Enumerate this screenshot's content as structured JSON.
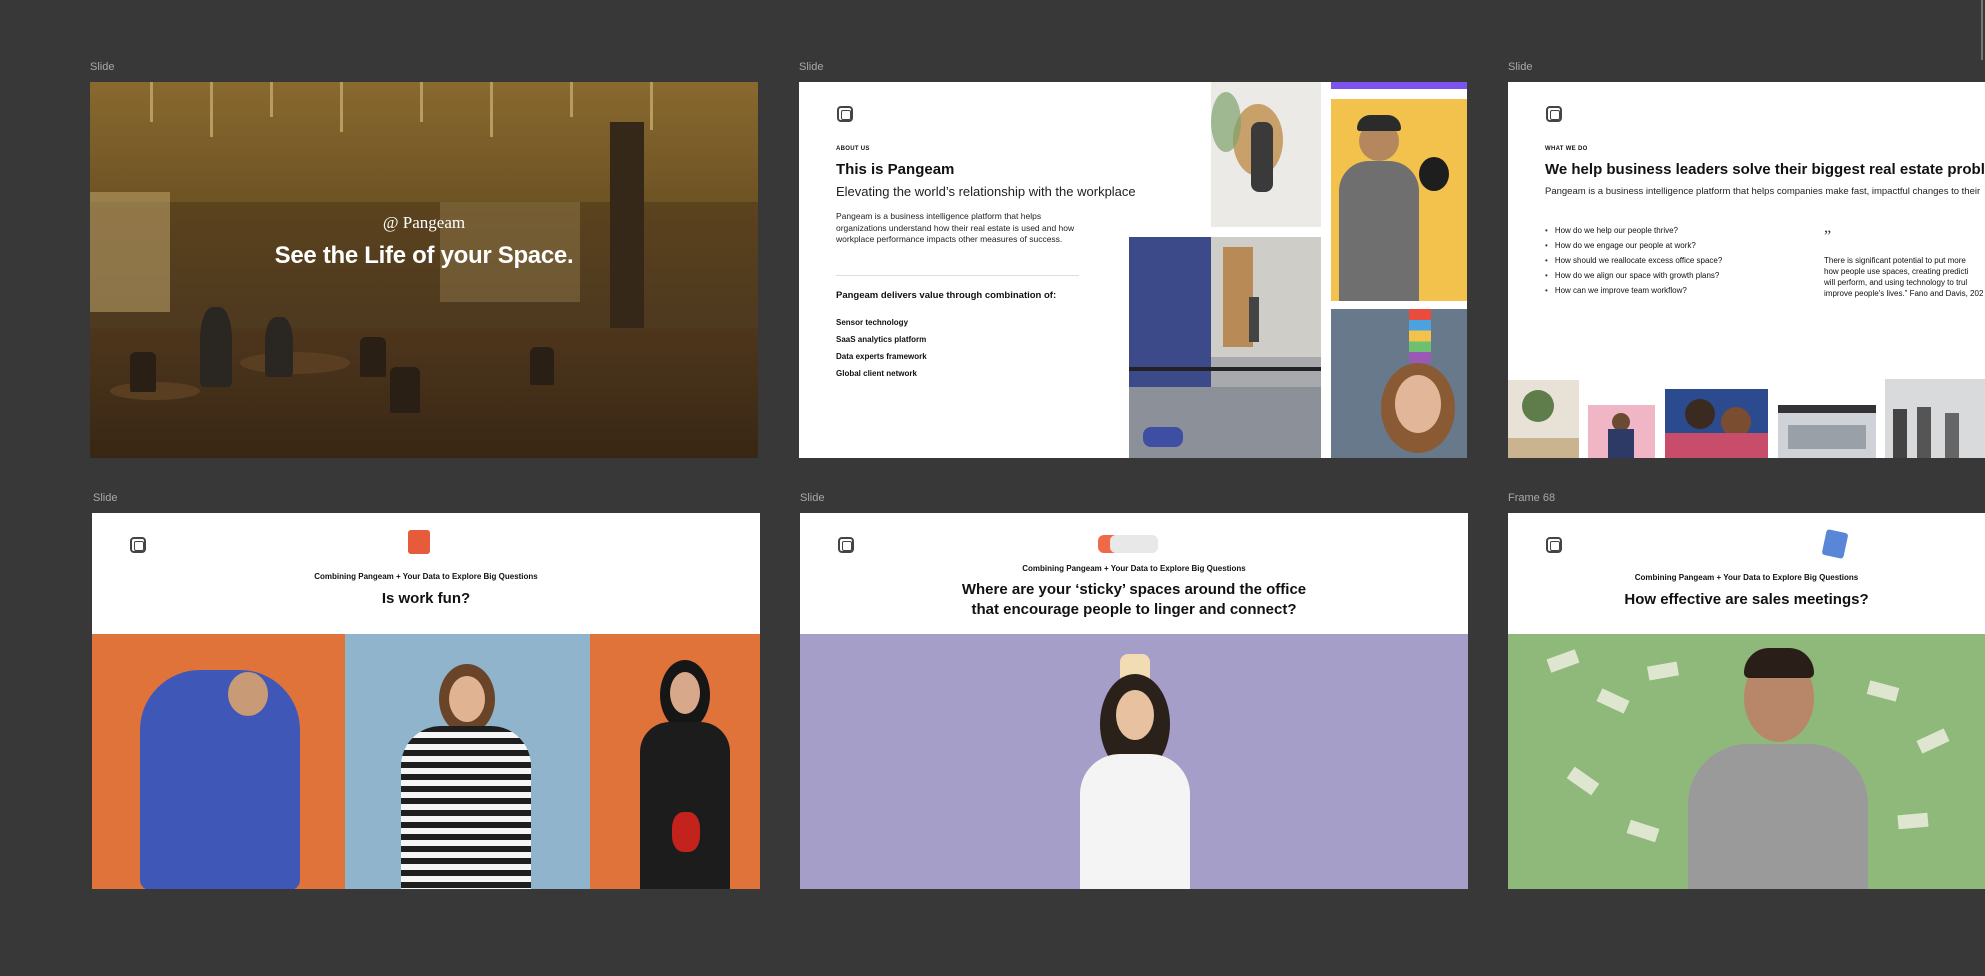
{
  "canvas": {
    "frames": [
      {
        "label": "Slide"
      },
      {
        "label": "Slide"
      },
      {
        "label": "Slide"
      },
      {
        "label": "Slide"
      },
      {
        "label": "Slide"
      },
      {
        "label": "Frame 68"
      }
    ]
  },
  "slide1": {
    "logo": "@ Pangeam",
    "title": "See the Life of your Space."
  },
  "slide2": {
    "eyebrow": "ABOUT US",
    "title": "This is Pangeam",
    "subtitle": "Elevating the world’s relationship with the workplace",
    "body": "Pangeam is a business intelligence platform that helps organizations understand how their real estate is used and how workplace performance impacts other measures of success.",
    "lead": "Pangeam delivers value through combination of:",
    "items": [
      "Sensor technology",
      "SaaS analytics platform",
      "Data experts framework",
      "Global client network"
    ]
  },
  "slide3": {
    "eyebrow": "WHAT WE DO",
    "title": "We help business leaders solve their biggest real estate proble",
    "subtitle": "Pangeam is a business intelligence platform that helps companies make fast, impactful changes to their",
    "questions": [
      "How do we help our people thrive?",
      "How do we engage our people at work?",
      "How should we reallocate excess office space?",
      "How do we align our space with growth plans?",
      "How can we improve team workflow?"
    ],
    "quote_mark": "”",
    "quote_lines": [
      "There is significant potential to put more",
      "how people use spaces, creating predicti",
      "will perform, and using technology to trul",
      "improve people's lives.” Fano and Davis, 202"
    ]
  },
  "slide4": {
    "kicker": "Combining Pangeam + Your Data to Explore Big Questions",
    "question": "Is work fun?"
  },
  "slide5": {
    "kicker": "Combining Pangeam + Your Data to Explore Big Questions",
    "question_line1": "Where are your ‘sticky’ spaces around the office",
    "question_line2": "that encourage people to linger and connect?"
  },
  "slide6": {
    "kicker": "Combining Pangeam + Your Data to Explore Big Questions",
    "question": "How effective are sales meetings?"
  },
  "colors": {
    "canvas": "#383838",
    "orange": "#e0733a",
    "blue": "#8fb4cc",
    "lavender": "#a59ec8",
    "green": "#8fb97a",
    "yellow": "#f3c24c",
    "purple": "#7b54f0"
  }
}
